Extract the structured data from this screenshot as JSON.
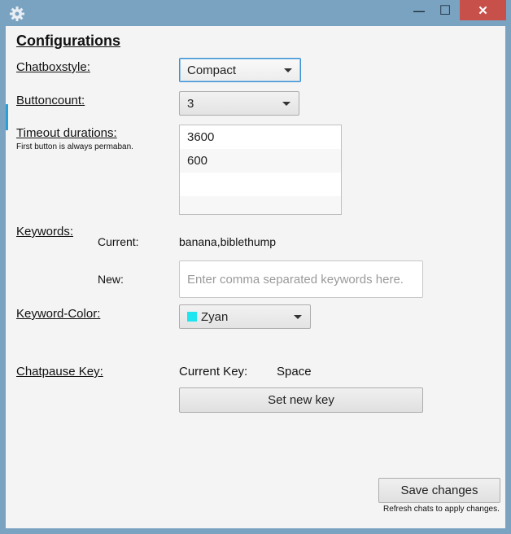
{
  "window": {
    "controls": {
      "minimize": "—",
      "maximize": "☐",
      "close": "✕"
    },
    "close_color": "#c7504b"
  },
  "config": {
    "heading": "Configurations",
    "chatboxstyle": {
      "label": "Chatboxstyle:",
      "selected": "Compact"
    },
    "buttoncount": {
      "label": "Buttoncount:",
      "selected": "3"
    },
    "timeout": {
      "label": "Timeout durations:",
      "note": "First button is always permaban.",
      "items": [
        "3600",
        "600"
      ]
    },
    "keywords": {
      "label": "Keywords:",
      "current_label": "Current:",
      "current_value": "banana,biblethump",
      "new_label": "New:",
      "new_placeholder": "Enter comma separated keywords here."
    },
    "keyword_color": {
      "label": "Keyword-Color:",
      "selected": "Zyan",
      "swatch": "#1ee6f0"
    },
    "chatpause": {
      "label": "Chatpause Key:",
      "current_label": "Current Key:",
      "current_value": "Space",
      "set_button": "Set new key"
    },
    "save_button": "Save changes",
    "save_note": "Refresh chats to apply changes."
  }
}
